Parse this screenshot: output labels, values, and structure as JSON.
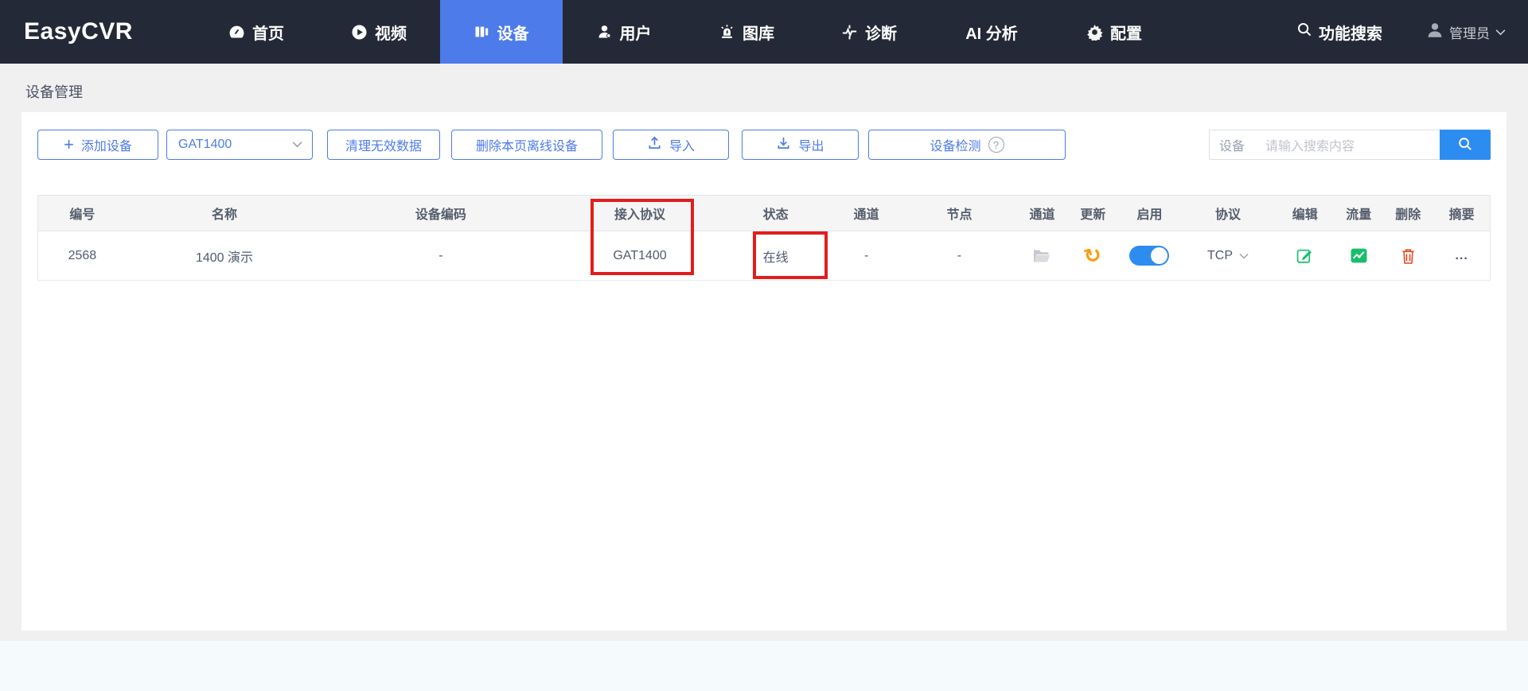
{
  "nav": {
    "logo": "EasyCVR",
    "items": [
      {
        "label": "首页"
      },
      {
        "label": "视频"
      },
      {
        "label": "设备"
      },
      {
        "label": "用户"
      },
      {
        "label": "图库"
      },
      {
        "label": "诊断"
      },
      {
        "label": "AI 分析"
      },
      {
        "label": "配置"
      }
    ],
    "search_label": "功能搜索",
    "user_label": "管理员"
  },
  "breadcrumb": "设备管理",
  "toolbar": {
    "add_device": "添加设备",
    "protocol_select_value": "GAT1400",
    "clean_invalid": "清理无效数据",
    "delete_offline": "删除本页离线设备",
    "import": "导入",
    "export": "导出",
    "device_check": "设备检测",
    "help_mark": "?",
    "search_prefix": "设备",
    "search_placeholder": "请输入搜索内容"
  },
  "table": {
    "headers": [
      "编号",
      "名称",
      "设备编码",
      "接入协议",
      "状态",
      "通道",
      "节点",
      "通道",
      "更新",
      "启用",
      "协议",
      "编辑",
      "流量",
      "删除",
      "摘要"
    ],
    "row": {
      "id": "2568",
      "name": "1400 演示",
      "device_code": "-",
      "protocol": "GAT1400",
      "status": "在线",
      "channel": "-",
      "node": "-",
      "refresh_glyph": "↻",
      "stream_protocol": "TCP",
      "summary": "...",
      "enabled": "on"
    }
  },
  "colors": {
    "nav_bg": "#232936",
    "active_tab": "#4d7bea",
    "primary_blue": "#2d8cf0",
    "online_green": "#19be6b",
    "refresh_orange": "#ff9900",
    "delete_red": "#ed4014",
    "annotation_red": "#e11d1d"
  }
}
